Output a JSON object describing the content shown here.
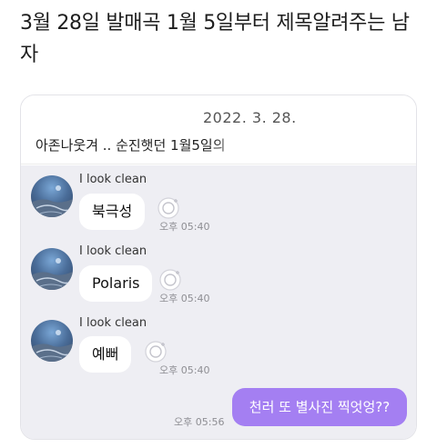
{
  "post": {
    "title": "3월 28일 발매곡 1월 5일부터 제목알려주는 남자"
  },
  "chat_card": {
    "date": "2022. 3. 28.",
    "preview": "아존나웃겨 .. 순진햇던 1월5일의"
  },
  "messages": [
    {
      "sender": "I look clean",
      "text": "북극성",
      "time": "오후 05:40"
    },
    {
      "sender": "I look clean",
      "text": "Polaris",
      "time": "오후 05:40"
    },
    {
      "sender": "I look clean",
      "text": "예뻐",
      "time": "오후 05:40"
    }
  ],
  "my_message": {
    "text": "천러 또 별사진 찍엇엉??",
    "time": "오후 05:56"
  },
  "colors": {
    "chat_background": "#eeeef3",
    "my_bubble": "#a47ff2",
    "incoming_bubble": "#ffffff"
  },
  "icons": {
    "reaction": "add-reaction-icon",
    "avatar": "sky-photo-avatar"
  }
}
